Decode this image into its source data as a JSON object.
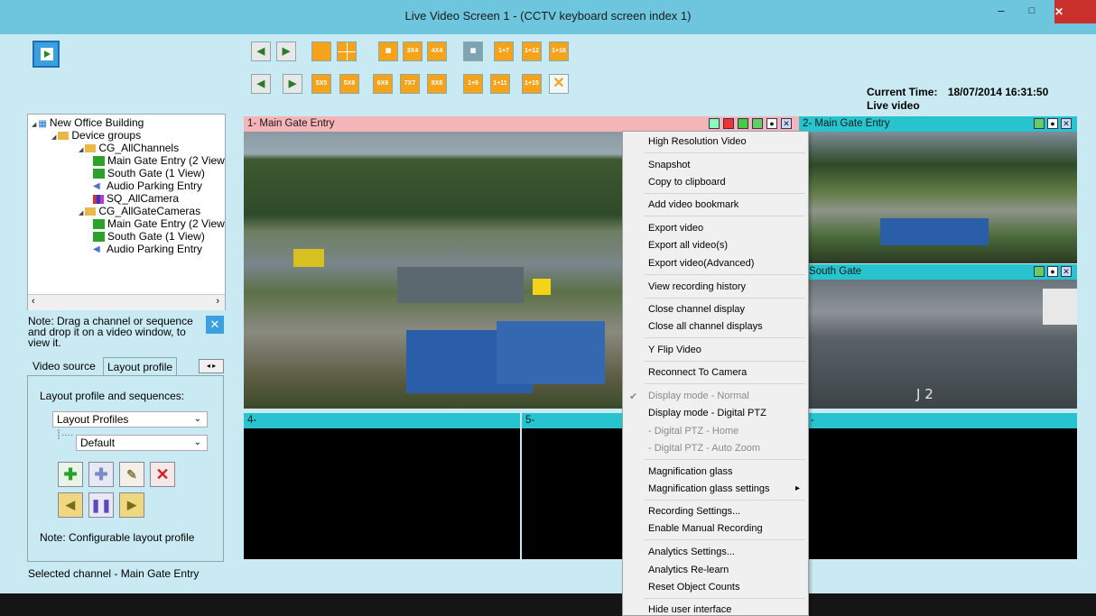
{
  "window": {
    "title": "Live Video Screen 1 - (CCTV keyboard screen index 1)",
    "minimize": "–",
    "restore": "□",
    "close": "✕"
  },
  "toolbar": {
    "row1": [
      "",
      "",
      "",
      "",
      "",
      "3X4",
      "4X4",
      "",
      "1+7",
      "1+12",
      "1+16"
    ],
    "row2": [
      "",
      "",
      "5X5",
      "5X6",
      "6X6",
      "7X7",
      "8X8",
      "1+9",
      "1+11",
      "1+15",
      ""
    ]
  },
  "status": {
    "current_time_label": "Current Time:",
    "current_time_value": "18/07/2014 16:31:50",
    "mode": "Live video"
  },
  "tree": {
    "items": [
      {
        "label": "New Office Building",
        "icon": "building-icon"
      },
      {
        "label": "Device groups",
        "icon": "folder-icon"
      },
      {
        "label": "CG_AllChannels",
        "icon": "folder-icon"
      },
      {
        "label": "Main Gate Entry (2 View",
        "icon": "camera-icon"
      },
      {
        "label": "South Gate (1 View)",
        "icon": "camera-icon"
      },
      {
        "label": "Audio Parking Entry",
        "icon": "audio-icon"
      },
      {
        "label": "SQ_AllCamera",
        "icon": "sequence-icon"
      },
      {
        "label": "CG_AllGateCameras",
        "icon": "folder-icon"
      },
      {
        "label": "Main Gate Entry (2 View",
        "icon": "camera-icon"
      },
      {
        "label": "South Gate (1 View)",
        "icon": "camera-icon"
      },
      {
        "label": "Audio Parking Entry",
        "icon": "audio-icon"
      }
    ]
  },
  "note_drag": "Note: Drag a channel or sequence and drop it on a video window, to view it.",
  "tabs": {
    "video_source": "Video source",
    "layout_profile": "Layout profile",
    "scroll_left": "◂",
    "scroll_right": "▸"
  },
  "layout_panel": {
    "heading": "Layout profile and sequences:",
    "profile_select": "Layout Profiles",
    "tree_prefix": "┊····",
    "default_select": "Default",
    "note": "Note: Configurable layout profile"
  },
  "selected_channel": "Selected channel - Main Gate Entry",
  "videos": {
    "v1": "1- Main Gate Entry",
    "v2": "2- Main Gate Entry",
    "v3": "- South Gate",
    "v4": "4-",
    "v5": "5-",
    "v6": "-",
    "overlay_text": "J 2"
  },
  "context_menu": {
    "items": [
      "High Resolution Video",
      "Snapshot",
      "Copy to clipboard",
      "Add video bookmark",
      "Export video",
      "Export all video(s)",
      "Export video(Advanced)",
      "View recording history",
      "Close channel display",
      "Close all channel displays",
      "Y Flip Video",
      "Reconnect To Camera",
      "Display mode - Normal",
      "Display mode - Digital PTZ",
      "- Digital PTZ - Home",
      "- Digital PTZ - Auto Zoom",
      "Magnification glass",
      "Magnification glass settings",
      "Recording Settings...",
      "Enable Manual Recording",
      "Analytics Settings...",
      "Analytics Re-learn",
      "Reset Object Counts",
      "Hide user interface"
    ],
    "check": "✔",
    "submenu_arrow": "▸"
  },
  "colors": {
    "titlebar": "#6ec6de",
    "background": "#c9eaf3",
    "video_header_active": "#f4b4b8",
    "video_header": "#27c4cf",
    "toolbar_orange": "#f5a31a"
  }
}
